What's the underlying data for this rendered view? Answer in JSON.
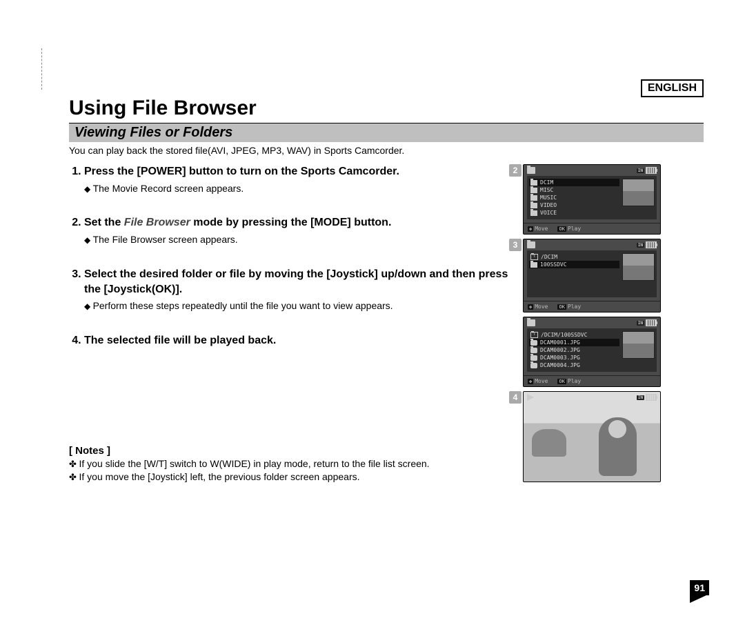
{
  "lang_label": "ENGLISH",
  "title": "Using File Browser",
  "subtitle": "Viewing Files or Folders",
  "intro": "You can play back the stored file(AVI, JPEG, MP3, WAV) in Sports Camcorder.",
  "steps": [
    {
      "text_before": "Press the [POWER] button to turn on the Sports Camcorder.",
      "em": "",
      "text_after": "",
      "sub": [
        "The Movie Record screen appears."
      ]
    },
    {
      "text_before": "Set the ",
      "em": "File Browser",
      "text_after": " mode by pressing the [MODE] button.",
      "sub": [
        "The File Browser screen appears."
      ]
    },
    {
      "text_before": "Select the desired folder or file by moving the [Joystick] up/down and then press the [Joystick(OK)].",
      "em": "",
      "text_after": "",
      "sub": [
        "Perform these steps repeatedly until the file you want to view appears."
      ]
    },
    {
      "text_before": "The selected file will be played back.",
      "em": "",
      "text_after": "",
      "sub": []
    }
  ],
  "notes_label": "[ Notes ]",
  "notes": [
    "If you slide the [W/T] switch to W(WIDE) in play mode, return to the file list screen.",
    "If you move the [Joystick] left, the previous folder screen appears."
  ],
  "screens": {
    "s2": {
      "num": "2",
      "battery_label": "IN",
      "items": [
        "DCIM",
        "MISC",
        "MUSIC",
        "VIDEO",
        "VOICE"
      ],
      "move": "Move",
      "play": "Play"
    },
    "s3": {
      "num": "3",
      "battery_label": "IN",
      "up": "/DCIM",
      "items": [
        "100SSDVC"
      ],
      "move": "Move",
      "play": "Play"
    },
    "s3b": {
      "battery_label": "IN",
      "up": "/DCIM/100SSDVC",
      "items": [
        "DCAM0001.JPG",
        "DCAM0002.JPG",
        "DCAM0003.JPG",
        "DCAM0004.JPG"
      ],
      "move": "Move",
      "play": "Play"
    },
    "s4": {
      "num": "4",
      "battery_label": "IN"
    }
  },
  "page_number": "91"
}
